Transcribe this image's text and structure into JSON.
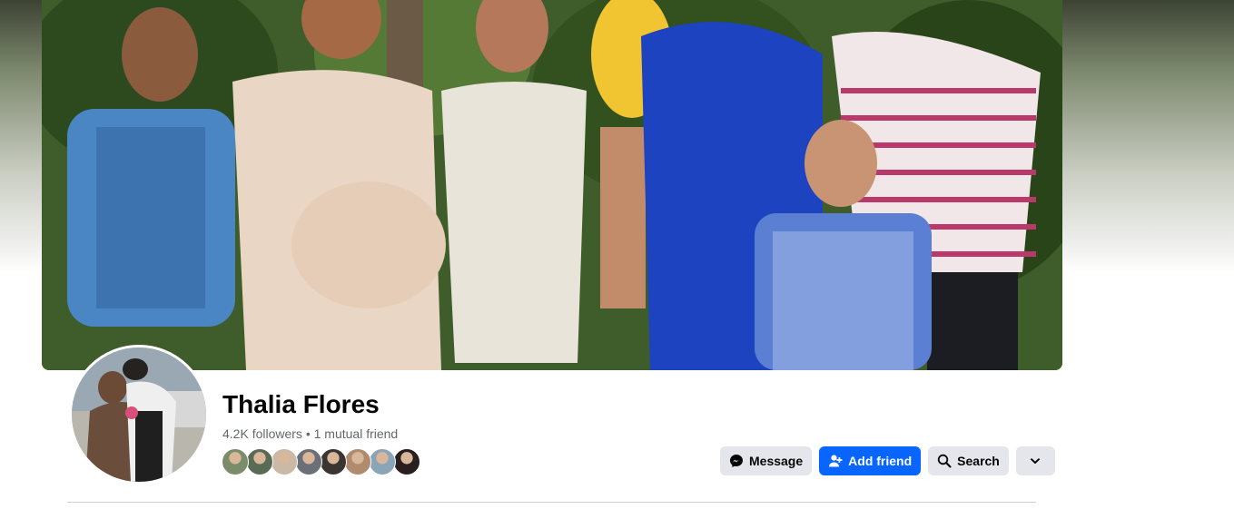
{
  "profile": {
    "name": "Thalia Flores",
    "stats": "4.2K followers • 1 mutual friend",
    "mutual_friend_avatars": [
      {
        "color": "#7b8c6a"
      },
      {
        "color": "#5a6b55"
      },
      {
        "color": "#c9b9a5"
      },
      {
        "color": "#6b7078"
      },
      {
        "color": "#3a3433"
      },
      {
        "color": "#b08b6e"
      },
      {
        "color": "#8aa4b8"
      },
      {
        "color": "#2a1e1e"
      }
    ]
  },
  "actions": {
    "message_label": "Message",
    "add_friend_label": "Add friend",
    "search_label": "Search"
  },
  "colors": {
    "primary_button": "#0866ff",
    "secondary_button": "#e4e6eb",
    "secondary_text": "#65676b"
  }
}
